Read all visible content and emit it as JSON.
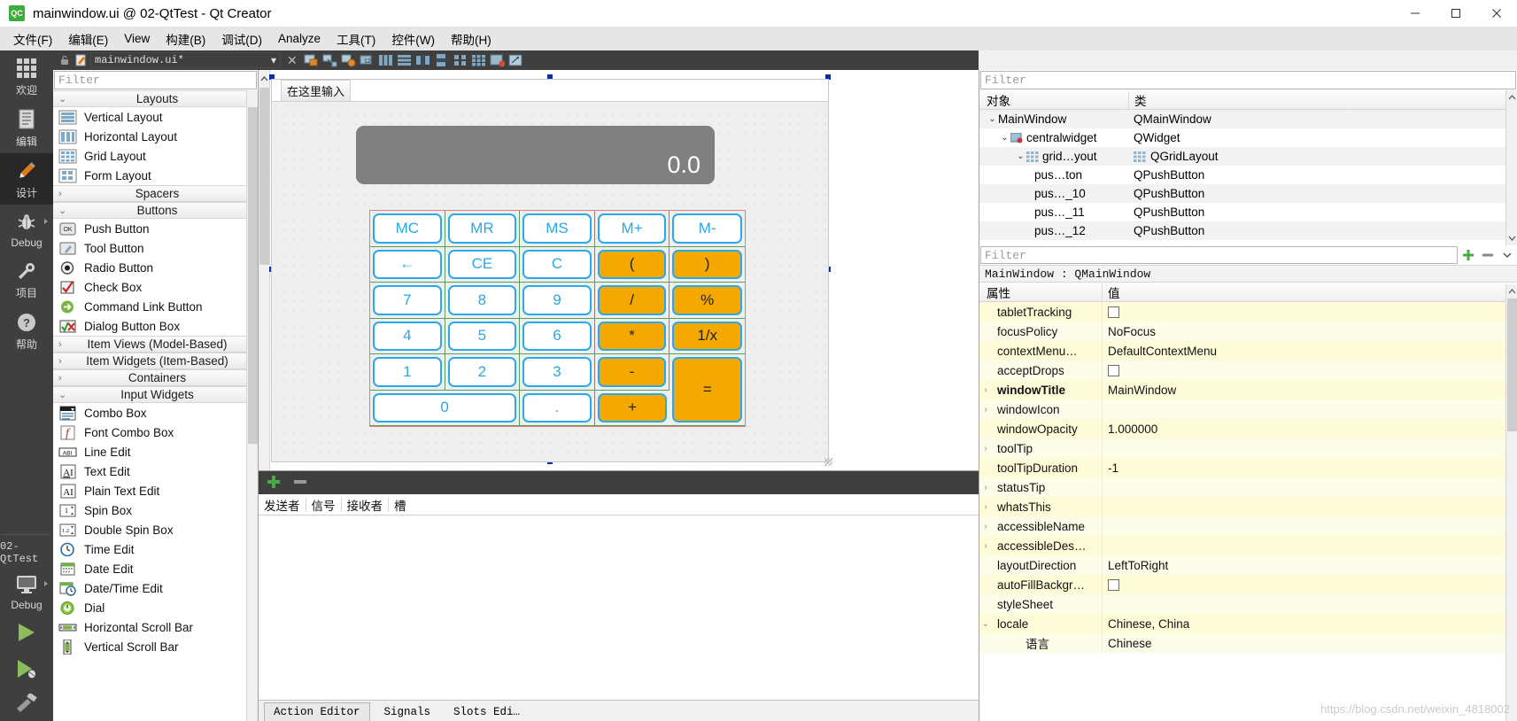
{
  "window": {
    "title": "mainwindow.ui @ 02-QtTest - Qt Creator",
    "logo_text": "QC",
    "minimize": "—",
    "maximize": "☐",
    "close": "✕"
  },
  "menubar": {
    "items": [
      {
        "label": "文件(F)",
        "name": "menu-file"
      },
      {
        "label": "编辑(E)",
        "name": "menu-edit"
      },
      {
        "label": "View",
        "name": "menu-view"
      },
      {
        "label": "构建(B)",
        "name": "menu-build"
      },
      {
        "label": "调试(D)",
        "name": "menu-debug"
      },
      {
        "label": "Analyze",
        "name": "menu-analyze"
      },
      {
        "label": "工具(T)",
        "name": "menu-tools"
      },
      {
        "label": "控件(W)",
        "name": "menu-widgets"
      },
      {
        "label": "帮助(H)",
        "name": "menu-help"
      }
    ]
  },
  "modebar": {
    "modes": [
      {
        "label": "欢迎",
        "icon": "grid-icon",
        "active": false
      },
      {
        "label": "编辑",
        "icon": "document-icon",
        "active": false
      },
      {
        "label": "设计",
        "icon": "pencil-icon",
        "active": true
      },
      {
        "label": "Debug",
        "icon": "bug-icon",
        "active": false
      },
      {
        "label": "项目",
        "icon": "wrench-icon",
        "active": false
      },
      {
        "label": "帮助",
        "icon": "question-icon",
        "active": false
      }
    ],
    "kit_name": "02-QtTest",
    "build_config": "Debug",
    "run_label": "run-button",
    "debug_label": "debug-button"
  },
  "editor_toolbar": {
    "filename": "mainwindow.ui*",
    "dropdown_arrow": "▾",
    "close_label": "✕",
    "icons": [
      "edit-widgets-icon",
      "edit-signals-icon",
      "edit-buddies-icon",
      "edit-tab-order-icon",
      "layout-horizontal-icon",
      "layout-vertical-icon",
      "layout-splitter-h-icon",
      "layout-splitter-v-icon",
      "layout-form-icon",
      "layout-grid-icon",
      "break-layout-icon",
      "adjust-size-icon"
    ]
  },
  "widget_box": {
    "filter_placeholder": "Filter",
    "groups": [
      {
        "name": "Layouts",
        "expanded": true,
        "chevron": "⌄",
        "items": [
          {
            "label": "Vertical Layout",
            "icon": "vertical-layout-icon"
          },
          {
            "label": "Horizontal Layout",
            "icon": "horizontal-layout-icon"
          },
          {
            "label": "Grid Layout",
            "icon": "grid-layout-icon"
          },
          {
            "label": "Form Layout",
            "icon": "form-layout-icon"
          }
        ]
      },
      {
        "name": "Spacers",
        "expanded": false,
        "chevron": "›",
        "items": []
      },
      {
        "name": "Buttons",
        "expanded": true,
        "chevron": "⌄",
        "items": [
          {
            "label": "Push Button",
            "icon": "push-button-icon"
          },
          {
            "label": "Tool Button",
            "icon": "tool-button-icon"
          },
          {
            "label": "Radio Button",
            "icon": "radio-button-icon"
          },
          {
            "label": "Check Box",
            "icon": "check-box-icon"
          },
          {
            "label": "Command Link Button",
            "icon": "command-link-icon"
          },
          {
            "label": "Dialog Button Box",
            "icon": "dialog-button-box-icon"
          }
        ]
      },
      {
        "name": "Item Views (Model-Based)",
        "expanded": false,
        "chevron": "›",
        "items": []
      },
      {
        "name": "Item Widgets (Item-Based)",
        "expanded": false,
        "chevron": "›",
        "items": []
      },
      {
        "name": "Containers",
        "expanded": false,
        "chevron": "›",
        "items": []
      },
      {
        "name": "Input Widgets",
        "expanded": true,
        "chevron": "⌄",
        "items": [
          {
            "label": "Combo Box",
            "icon": "combo-box-icon"
          },
          {
            "label": "Font Combo Box",
            "icon": "font-combo-box-icon"
          },
          {
            "label": "Line Edit",
            "icon": "line-edit-icon"
          },
          {
            "label": "Text Edit",
            "icon": "text-edit-icon"
          },
          {
            "label": "Plain Text Edit",
            "icon": "plain-text-edit-icon"
          },
          {
            "label": "Spin Box",
            "icon": "spin-box-icon"
          },
          {
            "label": "Double Spin Box",
            "icon": "double-spin-box-icon"
          },
          {
            "label": "Time Edit",
            "icon": "time-edit-icon"
          },
          {
            "label": "Date Edit",
            "icon": "date-edit-icon"
          },
          {
            "label": "Date/Time Edit",
            "icon": "date-time-edit-icon"
          },
          {
            "label": "Dial",
            "icon": "dial-icon"
          },
          {
            "label": "Horizontal Scroll Bar",
            "icon": "h-scrollbar-icon"
          },
          {
            "label": "Vertical Scroll Bar",
            "icon": "v-scrollbar-icon"
          }
        ]
      }
    ]
  },
  "form": {
    "menubar_placeholder": "在这里输入",
    "display_value": "0.0",
    "display_bg": "#808080",
    "button_blue": "#29a8e8",
    "button_orange": "#f5a800",
    "buttons": [
      {
        "label": "MC",
        "kind": "mem"
      },
      {
        "label": "MR",
        "kind": "mem"
      },
      {
        "label": "MS",
        "kind": "mem"
      },
      {
        "label": "M+",
        "kind": "mem"
      },
      {
        "label": "M-",
        "kind": "mem"
      },
      {
        "label": "←",
        "kind": "fn"
      },
      {
        "label": "CE",
        "kind": "fn"
      },
      {
        "label": "C",
        "kind": "fn"
      },
      {
        "label": "(",
        "kind": "op"
      },
      {
        "label": ")",
        "kind": "op"
      },
      {
        "label": "7",
        "kind": "num"
      },
      {
        "label": "8",
        "kind": "num"
      },
      {
        "label": "9",
        "kind": "num"
      },
      {
        "label": "/",
        "kind": "op"
      },
      {
        "label": "%",
        "kind": "op"
      },
      {
        "label": "4",
        "kind": "num"
      },
      {
        "label": "5",
        "kind": "num"
      },
      {
        "label": "6",
        "kind": "num"
      },
      {
        "label": "*",
        "kind": "op"
      },
      {
        "label": "1/x",
        "kind": "op"
      },
      {
        "label": "1",
        "kind": "num"
      },
      {
        "label": "2",
        "kind": "num"
      },
      {
        "label": "3",
        "kind": "num"
      },
      {
        "label": "-",
        "kind": "op"
      },
      {
        "label": "=",
        "kind": "op"
      },
      {
        "label": "0",
        "kind": "num"
      },
      {
        "label": ".",
        "kind": "num"
      },
      {
        "label": "+",
        "kind": "op"
      }
    ]
  },
  "signal_slot_editor": {
    "add_label": "+",
    "remove_label": "−",
    "columns": [
      "发送者",
      "信号",
      "接收者",
      "槽"
    ],
    "tabs": [
      {
        "label": "Action Editor",
        "active": false
      },
      {
        "label": "Signals",
        "active": false
      },
      {
        "label": "Slots Edi…",
        "active": false
      }
    ]
  },
  "object_inspector": {
    "filter_placeholder": "Filter",
    "headers": [
      "对象",
      "类"
    ],
    "rows": [
      {
        "indent": 0,
        "chevron": "⌄",
        "icon": "",
        "object": "MainWindow",
        "class": "QMainWindow",
        "selected": true
      },
      {
        "indent": 1,
        "chevron": "⌄",
        "icon": "widget-icon",
        "object": "centralwidget",
        "class": "QWidget",
        "selected": false
      },
      {
        "indent": 2,
        "chevron": "⌄",
        "icon": "grid-layout-icon",
        "object": "grid…yout",
        "class": "QGridLayout",
        "selected": false
      },
      {
        "indent": 3,
        "chevron": "",
        "icon": "",
        "object": "pus…ton",
        "class": "QPushButton",
        "selected": false
      },
      {
        "indent": 3,
        "chevron": "",
        "icon": "",
        "object": "pus…_10",
        "class": "QPushButton",
        "selected": false
      },
      {
        "indent": 3,
        "chevron": "",
        "icon": "",
        "object": "pus…_11",
        "class": "QPushButton",
        "selected": false
      },
      {
        "indent": 3,
        "chevron": "",
        "icon": "",
        "object": "pus…_12",
        "class": "QPushButton",
        "selected": false
      }
    ]
  },
  "property_editor": {
    "filter_placeholder": "Filter",
    "add_label": "+",
    "remove_label": "−",
    "object_line": "MainWindow : QMainWindow",
    "headers": [
      "属性",
      "值"
    ],
    "rows": [
      {
        "chevron": "",
        "name": "tabletTracking",
        "value": "",
        "checkbox": true,
        "bold": false
      },
      {
        "chevron": "",
        "name": "focusPolicy",
        "value": "NoFocus",
        "checkbox": false,
        "bold": false
      },
      {
        "chevron": "",
        "name": "contextMenu…",
        "value": "DefaultContextMenu",
        "checkbox": false,
        "bold": false
      },
      {
        "chevron": "",
        "name": "acceptDrops",
        "value": "",
        "checkbox": true,
        "bold": false
      },
      {
        "chevron": "›",
        "name": "windowTitle",
        "value": "MainWindow",
        "checkbox": false,
        "bold": true
      },
      {
        "chevron": "›",
        "name": "windowIcon",
        "value": "",
        "checkbox": false,
        "bold": false
      },
      {
        "chevron": "",
        "name": "windowOpacity",
        "value": "1.000000",
        "checkbox": false,
        "bold": false
      },
      {
        "chevron": "›",
        "name": "toolTip",
        "value": "",
        "checkbox": false,
        "bold": false
      },
      {
        "chevron": "",
        "name": "toolTipDuration",
        "value": "-1",
        "checkbox": false,
        "bold": false
      },
      {
        "chevron": "›",
        "name": "statusTip",
        "value": "",
        "checkbox": false,
        "bold": false
      },
      {
        "chevron": "›",
        "name": "whatsThis",
        "value": "",
        "checkbox": false,
        "bold": false
      },
      {
        "chevron": "›",
        "name": "accessibleName",
        "value": "",
        "checkbox": false,
        "bold": false
      },
      {
        "chevron": "›",
        "name": "accessibleDes…",
        "value": "",
        "checkbox": false,
        "bold": false
      },
      {
        "chevron": "",
        "name": "layoutDirection",
        "value": "LeftToRight",
        "checkbox": false,
        "bold": false
      },
      {
        "chevron": "",
        "name": "autoFillBackgr…",
        "value": "",
        "checkbox": true,
        "bold": false
      },
      {
        "chevron": "",
        "name": "styleSheet",
        "value": "",
        "checkbox": false,
        "bold": false
      },
      {
        "chevron": "⌄",
        "name": "locale",
        "value": "Chinese, China",
        "checkbox": false,
        "bold": false
      },
      {
        "chevron": "",
        "name": "语言",
        "value": "Chinese",
        "checkbox": false,
        "bold": false,
        "sub": true
      }
    ]
  },
  "watermark": "https://blog.csdn.net/weixin_4818002"
}
